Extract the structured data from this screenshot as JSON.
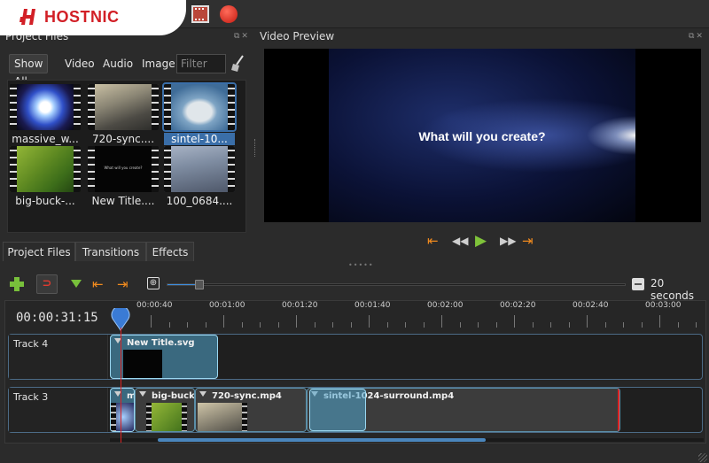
{
  "brand": {
    "logo_text": "HOSTNIC"
  },
  "panels": {
    "project_files_title": "Project Files",
    "video_preview_title": "Video Preview"
  },
  "filters": {
    "show_all": "Show All",
    "video": "Video",
    "audio": "Audio",
    "image": "Image",
    "filter_placeholder": "Filter"
  },
  "files": [
    {
      "label": "massive_w...",
      "thumb": "globe"
    },
    {
      "label": "720-sync....",
      "thumb": "sync"
    },
    {
      "label": "sintel-10...",
      "thumb": "sintel",
      "selected": true
    },
    {
      "label": "big-buck-...",
      "thumb": "bbb"
    },
    {
      "label": "New Title....",
      "thumb": "title",
      "thumb_text": "What will you create?"
    },
    {
      "label": "100_0684....",
      "thumb": "bed"
    }
  ],
  "tabs": [
    "Project Files",
    "Transitions",
    "Effects"
  ],
  "preview": {
    "caption": "What will you create?"
  },
  "timeline": {
    "timecode": "00:00:31:15",
    "zoom_label": "20 seconds",
    "zoom_level": 0.07,
    "ruler": [
      "00:00:40",
      "00:01:00",
      "00:01:20",
      "00:01:40",
      "00:02:00",
      "00:02:20",
      "00:02:40",
      "00:03:00"
    ],
    "tracks": [
      {
        "name": "Track 4",
        "clips": [
          {
            "title": "New Title.svg"
          }
        ]
      },
      {
        "name": "Track 3",
        "clips": [
          {
            "title": "m"
          },
          {
            "title": "big-buck-"
          },
          {
            "title": "720-sync.mp4"
          },
          {
            "title": "sintel-1024-surround.mp4"
          }
        ]
      }
    ],
    "scroll_position": 0.08
  },
  "colors": {
    "accent": "#3a6ea8",
    "selection_clip": "#50a5cd",
    "orange": "#f08a1e",
    "green": "#78c03b",
    "logo_red": "#d21f26"
  }
}
